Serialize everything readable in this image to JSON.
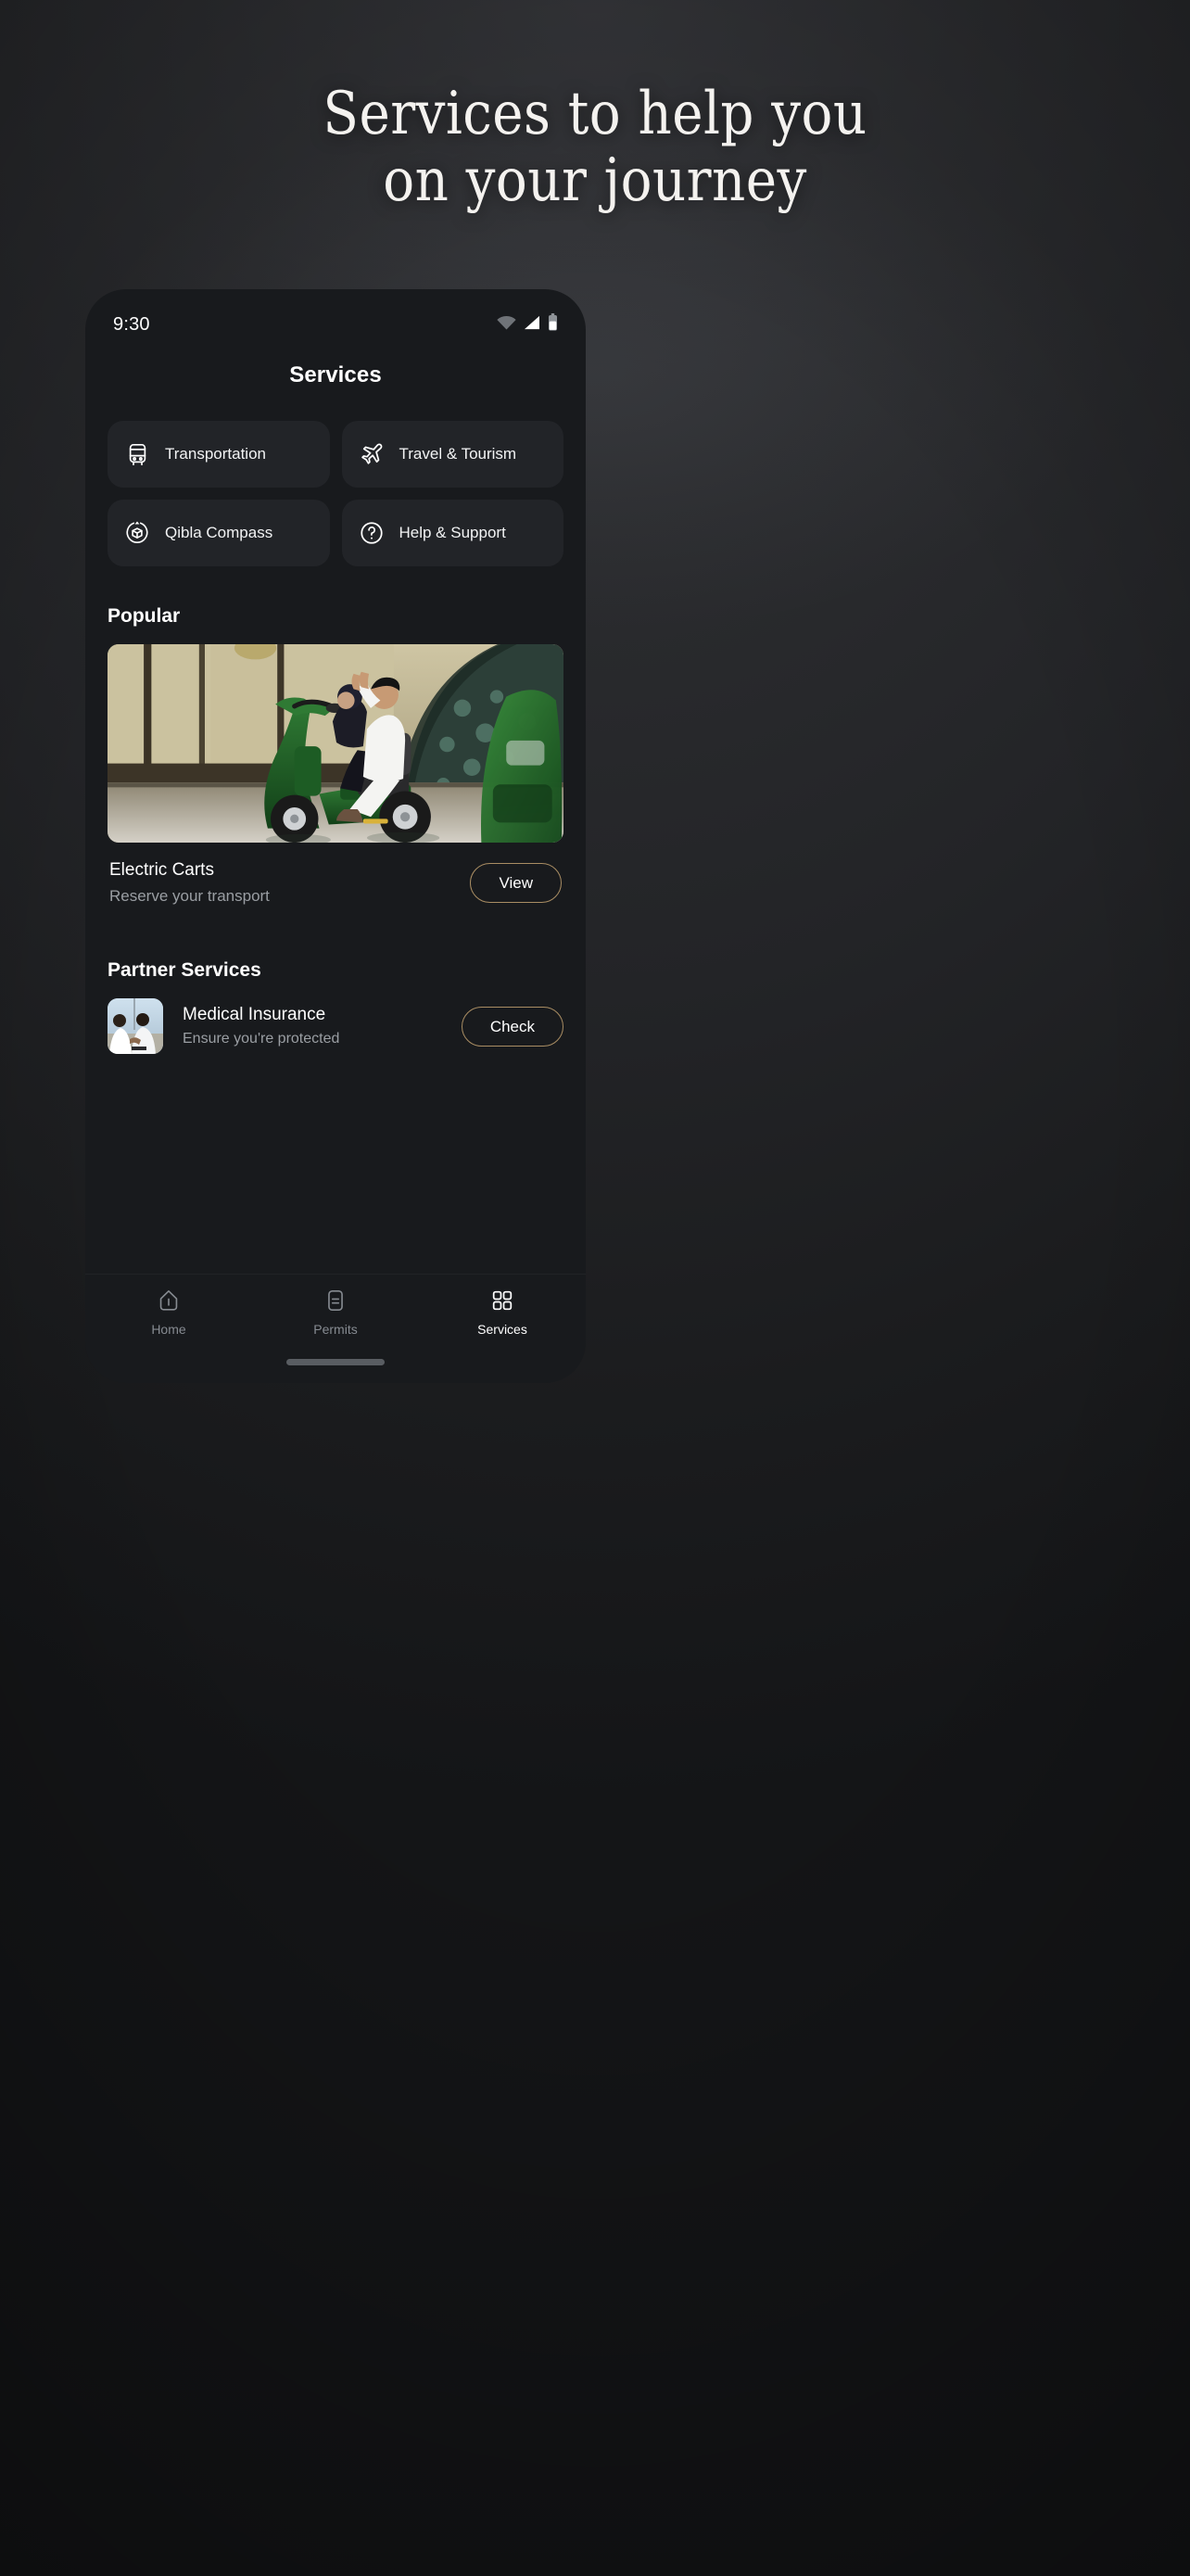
{
  "poster": {
    "headline_line1": "Services to help you",
    "headline_line2": "on your journey"
  },
  "phone": {
    "status_bar": {
      "time": "9:30",
      "icons": [
        "wifi-icon",
        "cellular-signal-icon",
        "battery-icon"
      ]
    },
    "app_bar": {
      "title": "Services"
    },
    "service_tiles": [
      {
        "label": "Transportation",
        "icon": "bus-icon"
      },
      {
        "label": "Travel & Tourism",
        "icon": "airplane-icon"
      },
      {
        "label": "Qibla Compass",
        "icon": "qibla-compass-icon"
      },
      {
        "label": "Help & Support",
        "icon": "question-circle-icon"
      }
    ],
    "popular": {
      "section_title": "Popular",
      "card": {
        "title": "Electric Carts",
        "subtitle": "Reserve your transport",
        "button_label": "View",
        "image_alt": "pilgrims-on-green-electric-cart"
      }
    },
    "partner_services": {
      "section_title": "Partner Services",
      "items": [
        {
          "title": "Medical Insurance",
          "subtitle": "Ensure you're protected",
          "button_label": "Check",
          "thumb_alt": "two-pilgrims-in-ihram"
        }
      ]
    },
    "bottom_nav": {
      "items": [
        {
          "label": "Home",
          "icon": "home-icon",
          "active": false
        },
        {
          "label": "Permits",
          "icon": "permit-card-icon",
          "active": false
        },
        {
          "label": "Services",
          "icon": "grid-squares-icon",
          "active": true
        }
      ]
    }
  },
  "colors": {
    "poster_bg": "#2b2c2f",
    "screen_bg": "#181A1D",
    "tile_bg": "#222428",
    "accent_gold": "#a98d63",
    "text_primary": "#ffffff",
    "text_secondary": "#9a9ea3"
  }
}
